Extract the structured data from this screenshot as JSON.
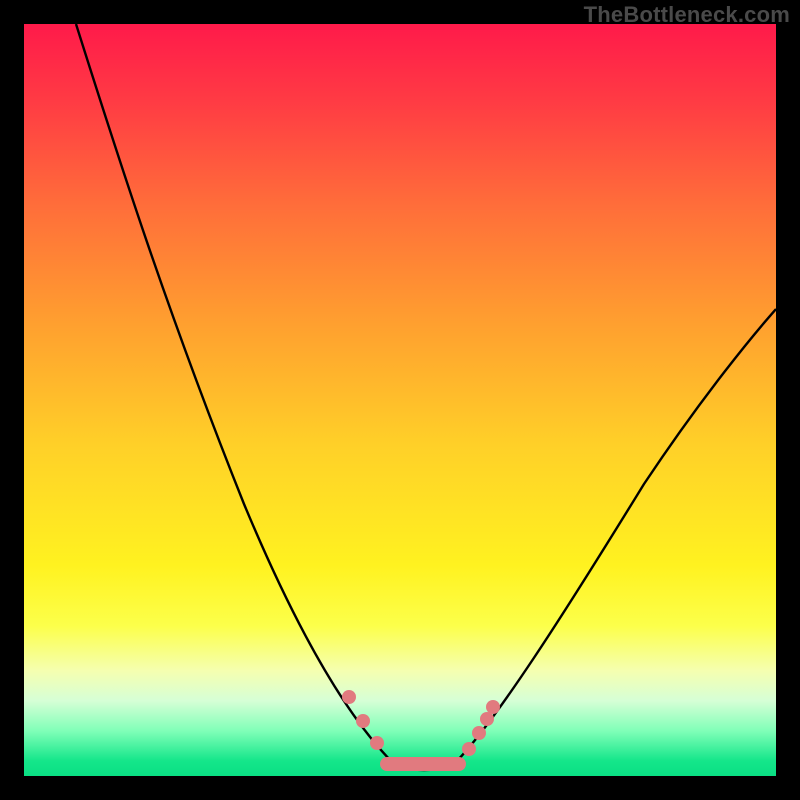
{
  "watermark": "TheBottleneck.com",
  "colors": {
    "background": "#000000",
    "curve": "#000000",
    "marker": "#e17a7f",
    "gradient_top": "#ff1a4a",
    "gradient_bottom": "#0adf84"
  },
  "chart_data": {
    "type": "line",
    "title": "",
    "xlabel": "",
    "ylabel": "",
    "xlim": [
      0,
      100
    ],
    "ylim": [
      0,
      100
    ],
    "series": [
      {
        "name": "left-curve",
        "x": [
          7,
          10,
          14,
          18,
          22,
          26,
          30,
          34,
          38,
          42,
          44,
          46,
          48,
          50
        ],
        "y": [
          100,
          92,
          82,
          72,
          62,
          52,
          42,
          33,
          24,
          14,
          9,
          5,
          2,
          0
        ]
      },
      {
        "name": "right-curve",
        "x": [
          56,
          58,
          61,
          65,
          70,
          76,
          82,
          88,
          94,
          100
        ],
        "y": [
          0,
          3,
          7,
          13,
          21,
          30,
          39,
          47,
          55,
          62
        ]
      },
      {
        "name": "valley-floor",
        "x": [
          48,
          50,
          52,
          54,
          56,
          58
        ],
        "y": [
          2,
          0,
          0,
          0,
          0,
          2
        ]
      }
    ],
    "markers": [
      {
        "name": "left-dot-1",
        "x": 44,
        "y": 9
      },
      {
        "name": "left-dot-2",
        "x": 46,
        "y": 5
      },
      {
        "name": "left-dot-3",
        "x": 48,
        "y": 2
      },
      {
        "name": "right-dot-1",
        "x": 58,
        "y": 3
      },
      {
        "name": "right-dot-2",
        "x": 60,
        "y": 6
      },
      {
        "name": "right-dot-3",
        "x": 61,
        "y": 8
      },
      {
        "name": "right-dot-4",
        "x": 62,
        "y": 10
      }
    ],
    "marker_strip": {
      "x_start": 48,
      "x_end": 58,
      "y": 0
    },
    "annotations": []
  }
}
